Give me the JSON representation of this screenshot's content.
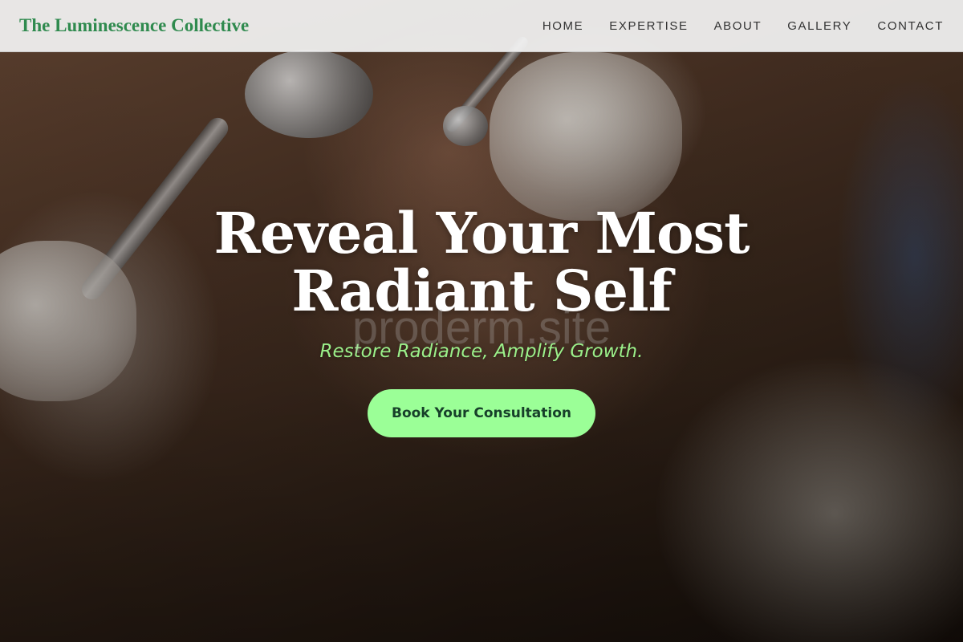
{
  "site": {
    "logo": "The Luminescence Collective"
  },
  "nav": {
    "items": [
      {
        "label": "HOME"
      },
      {
        "label": "EXPERTISE"
      },
      {
        "label": "ABOUT"
      },
      {
        "label": "GALLERY"
      },
      {
        "label": "CONTACT"
      }
    ]
  },
  "hero": {
    "headline": "Reveal Your Most Radiant Self",
    "watermark": "proderm.site",
    "tagline": "Restore Radiance, Amplify Growth.",
    "cta_label": "Book Your Consultation",
    "background_image": "facial-treatment-photo"
  },
  "colors": {
    "logo": "#2f8a4e",
    "accent_green": "#9bff97",
    "tagline": "#9bf08a",
    "header_bg": "#f3f3f3"
  }
}
